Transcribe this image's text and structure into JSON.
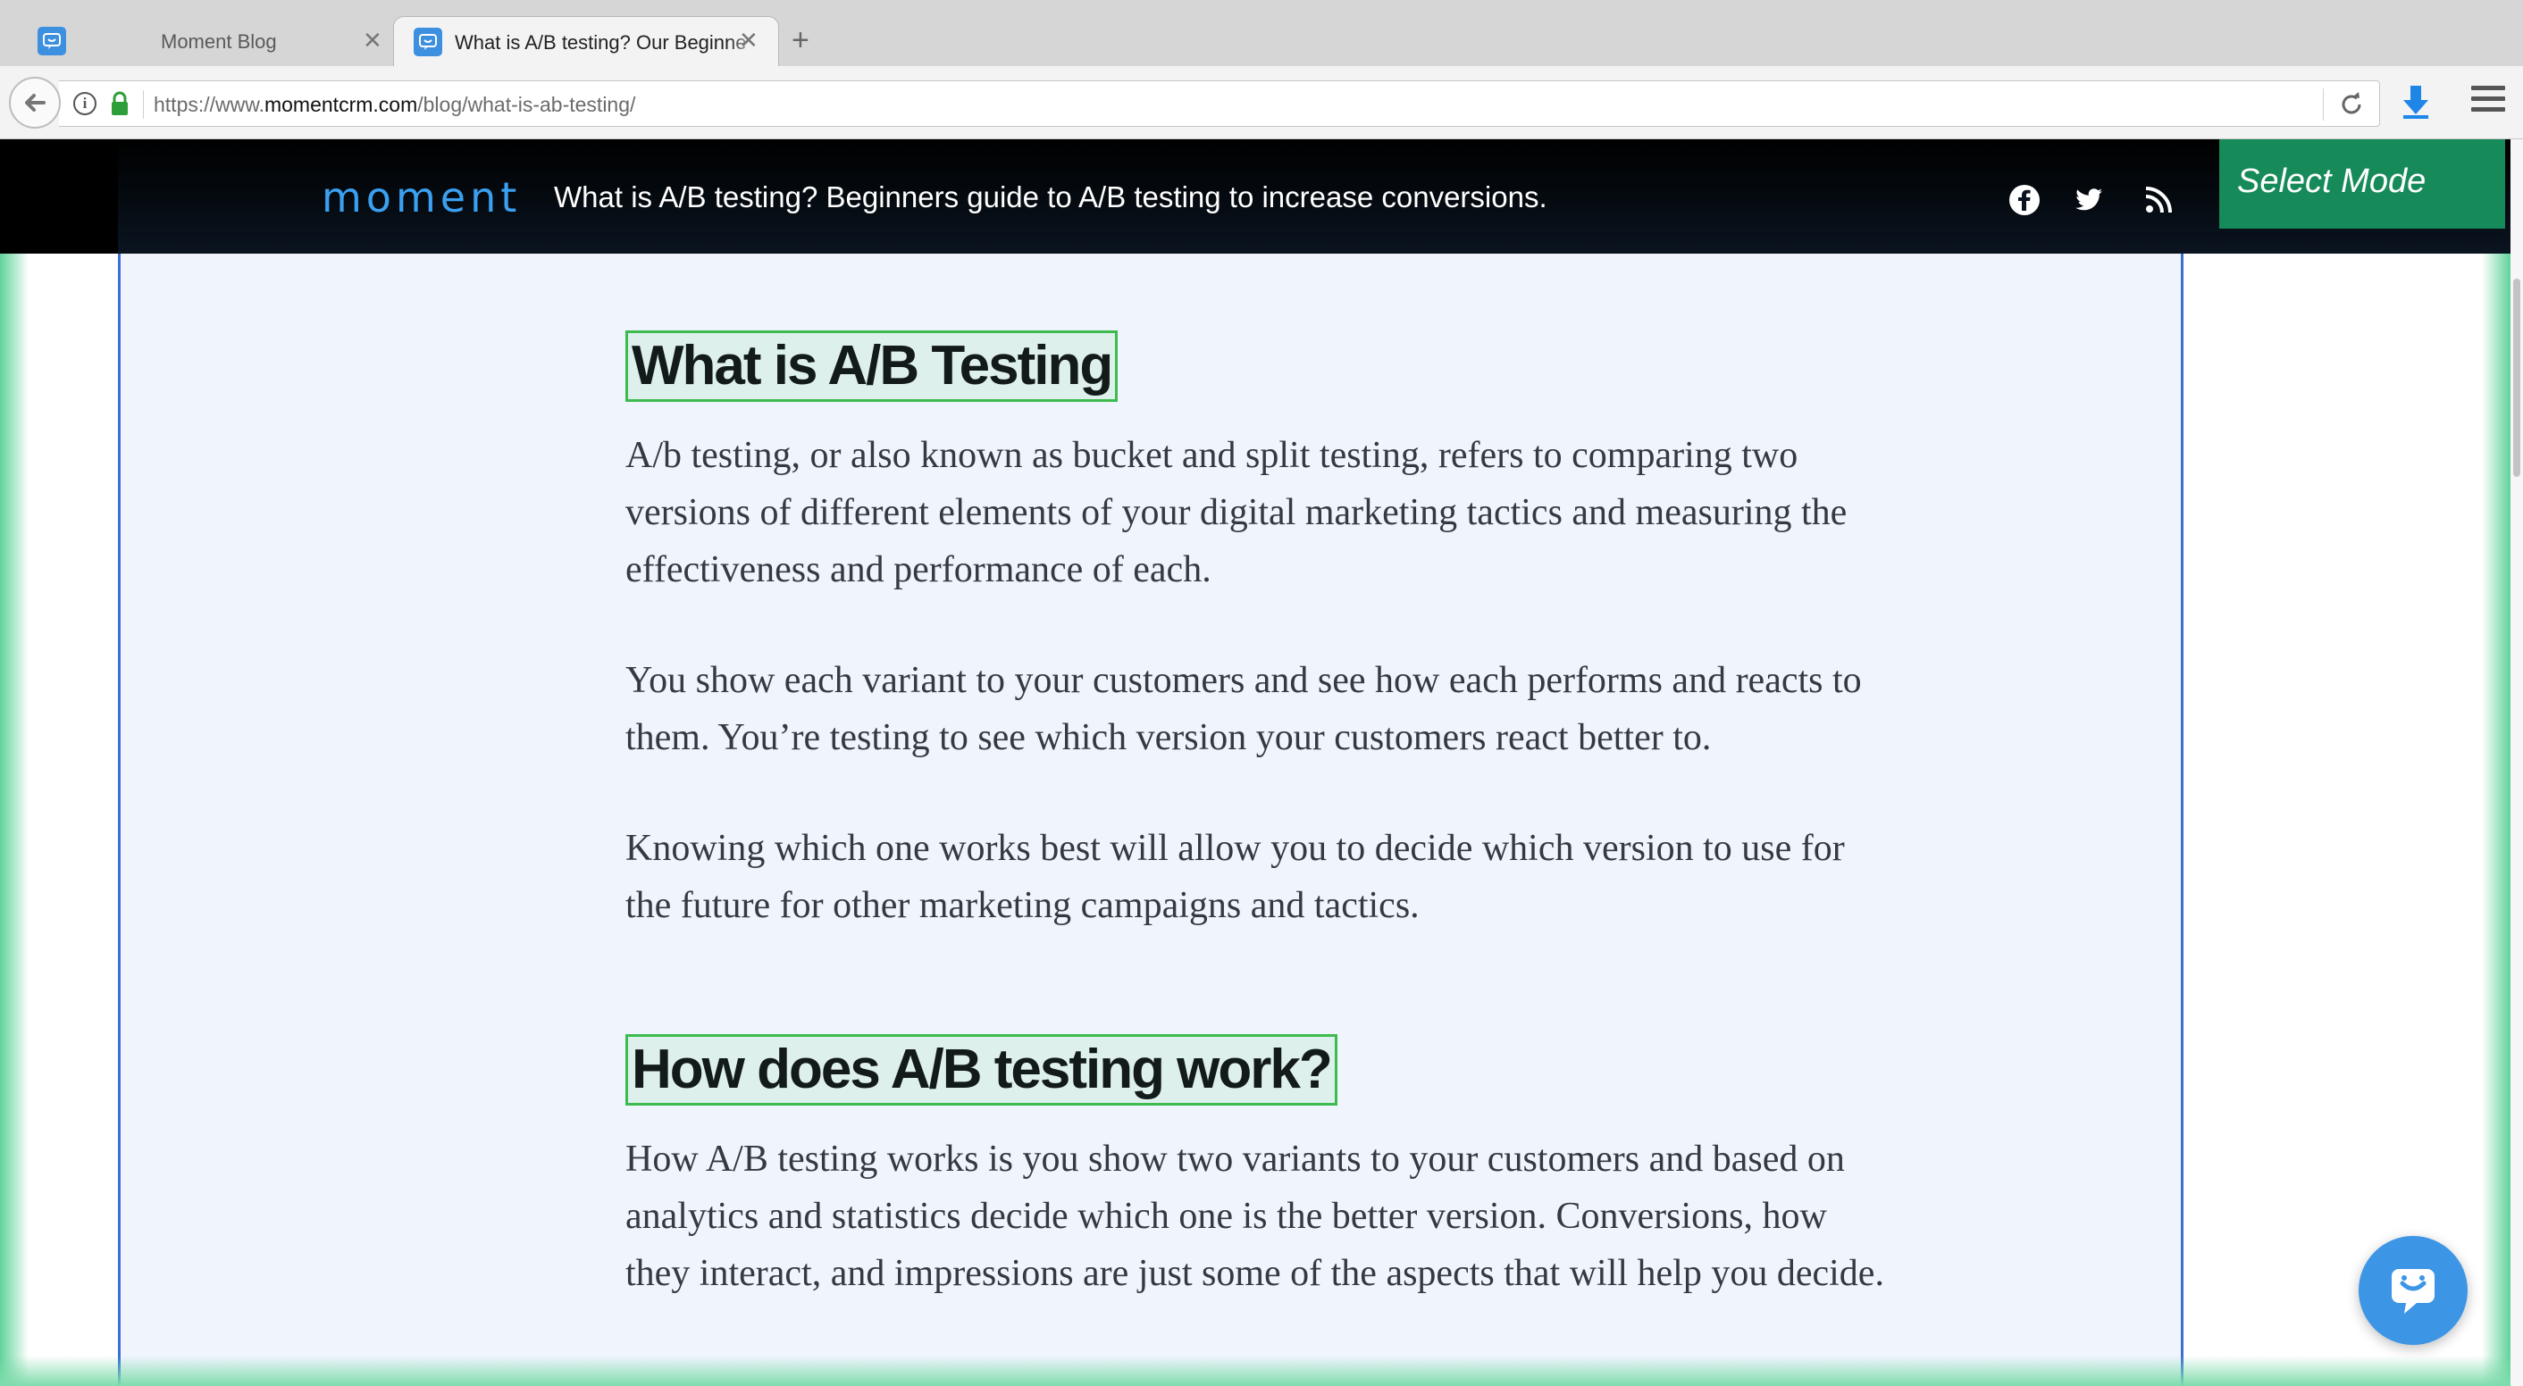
{
  "browser": {
    "tabs": [
      {
        "title": "Moment Blog",
        "close": "✕"
      },
      {
        "title": "What is A/B testing? Our Beginne",
        "close": "✕"
      }
    ],
    "new_tab": "+",
    "url": {
      "prefix": "https://www.",
      "domain": "momentcrm.com",
      "path": "/blog/what-is-ab-testing/"
    },
    "info_glyph": "i",
    "icons": [
      "moment-favicon",
      "back-arrow-icon",
      "info-icon",
      "lock-icon",
      "reload-icon",
      "download-icon",
      "hamburger-menu-icon"
    ]
  },
  "site": {
    "brand": "moment",
    "header_title": "What is A/B testing? Beginners guide to A/B testing to increase conversions.",
    "social_icons": [
      "facebook-icon",
      "twitter-icon",
      "rss-icon"
    ],
    "select_mode": "Select Mode"
  },
  "article": {
    "section1": {
      "heading": "What is A/B Testing",
      "paragraphs": [
        "A/b testing, or also known as bucket and split testing, refers to comparing two versions of different elements of your digital marketing tactics and measuring the effectiveness and performance of each.",
        "You show each variant to your customers and see how each performs and reacts to them. You’re testing to see which version your customers react better to.",
        "Knowing which one works best will allow you to decide which version to use for the future for other marketing campaigns and tactics."
      ]
    },
    "section2": {
      "heading": "How does A/B testing work?",
      "paragraphs": [
        "How A/B testing works is you show two variants to your customers and based on analytics and statistics decide which one is the better version. Conversions, how they interact, and impressions are just some of the aspects that will help you decide."
      ]
    }
  },
  "colors": {
    "brand_blue": "#3ba0f0",
    "select_mode_green": "#168a59",
    "highlight_green": "#3dbb4e",
    "selection_blue": "#3b6fd6"
  }
}
